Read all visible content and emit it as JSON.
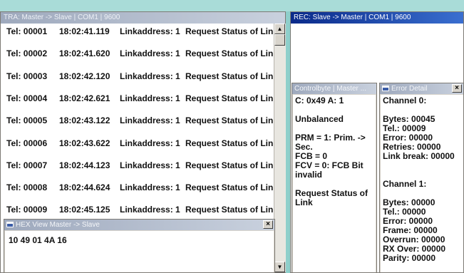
{
  "tra_window": {
    "title": "TRA: Master -> Slave | COM1 | 9600",
    "rows": [
      {
        "tel": "Tel: 00001",
        "time": "18:02:41.119",
        "link": "Linkaddress: 1",
        "msg": "Request Status of Link"
      },
      {
        "tel": "Tel: 00002",
        "time": "18:02:41.620",
        "link": "Linkaddress: 1",
        "msg": "Request Status of Link"
      },
      {
        "tel": "Tel: 00003",
        "time": "18:02:42.120",
        "link": "Linkaddress: 1",
        "msg": "Request Status of Link"
      },
      {
        "tel": "Tel: 00004",
        "time": "18:02:42.621",
        "link": "Linkaddress: 1",
        "msg": "Request Status of Link"
      },
      {
        "tel": "Tel: 00005",
        "time": "18:02:43.122",
        "link": "Linkaddress: 1",
        "msg": "Request Status of Link"
      },
      {
        "tel": "Tel: 00006",
        "time": "18:02:43.622",
        "link": "Linkaddress: 1",
        "msg": "Request Status of Link"
      },
      {
        "tel": "Tel: 00007",
        "time": "18:02:44.123",
        "link": "Linkaddress: 1",
        "msg": "Request Status of Link"
      },
      {
        "tel": "Tel: 00008",
        "time": "18:02:44.624",
        "link": "Linkaddress: 1",
        "msg": "Request Status of Link"
      },
      {
        "tel": "Tel: 00009",
        "time": "18:02:45.125",
        "link": "Linkaddress: 1",
        "msg": "Request Status of Link"
      }
    ],
    "scroll_up_glyph": "▲",
    "scroll_down_glyph": "▼"
  },
  "hex_window": {
    "title": "HEX View Master -> Slave",
    "close_glyph": "×",
    "content": "10 49 01 4A 16"
  },
  "rec_window": {
    "title": "REC: Slave -> Master | COM1 | 9600"
  },
  "controlbyte_window": {
    "title": "Controlbyte | Master ...",
    "lines": [
      "C: 0x49   A: 1",
      "",
      "Unbalanced",
      "",
      "PRM = 1: Prim. ->",
      "Sec.",
      "FCB = 0",
      "FCV = 0: FCB Bit",
      "invalid",
      "",
      "Request Status of",
      "Link"
    ]
  },
  "error_window": {
    "title": "Error Detail",
    "close_glyph": "×",
    "lines": [
      "Channel 0:",
      "",
      "Bytes: 00045",
      "Tel.: 00009",
      "Error: 00000",
      "Retries: 00000",
      "Link break: 00000",
      "",
      "",
      "Channel 1:",
      "",
      "Bytes: 00000",
      "Tel.: 00000",
      "Error: 00000",
      "Frame: 00000",
      "Overrun: 00000",
      "RX Over: 00000",
      "Parity: 00000"
    ]
  },
  "colors": {
    "background": "#8ecfcb",
    "active_title": "#0a2a8a",
    "inactive_title": "#9ea9bd"
  }
}
